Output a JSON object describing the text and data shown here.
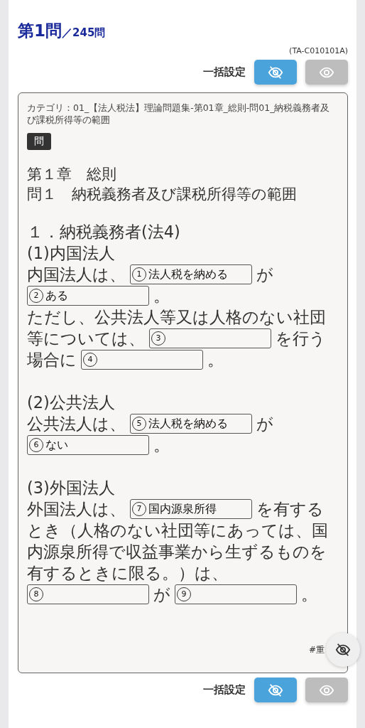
{
  "header": {
    "question": "第1問",
    "total": "／245問",
    "code": "(TA-C010101A)"
  },
  "bulk_top": {
    "label": "一括設定",
    "buttons": [
      {
        "kind": "hide",
        "selected": true
      },
      {
        "kind": "show",
        "selected": false
      }
    ]
  },
  "card": {
    "category": "カテゴリ：01_【法人税法】理論問題集-第01章_総則-問01_納税義務者及び課税所得等の範囲",
    "badge": "問",
    "heading": [
      "第１章　総則",
      "問１　納税義務者及び課税所得等の範囲"
    ],
    "paragraphs": [
      [
        [
          {
            "kind": "text",
            "text": "１．納税義務者(法4)"
          }
        ],
        [
          {
            "kind": "text",
            "text": "(1)内国法人"
          }
        ],
        [
          {
            "kind": "text",
            "text": "内国法人は、"
          },
          {
            "kind": "blank",
            "number": "1",
            "value": "法人税を納める"
          },
          {
            "kind": "text",
            "text": "が"
          }
        ],
        [
          {
            "kind": "blank",
            "number": "2",
            "value": "ある"
          },
          {
            "kind": "text",
            "text": "。"
          }
        ],
        [
          {
            "kind": "text",
            "text": "ただし、公共法人等又は人格のない社団"
          }
        ],
        [
          {
            "kind": "text",
            "text": "等については、"
          },
          {
            "kind": "blank",
            "number": "3"
          },
          {
            "kind": "text",
            "text": "を行う"
          }
        ],
        [
          {
            "kind": "text",
            "text": "場合に"
          },
          {
            "kind": "blank",
            "number": "4"
          },
          {
            "kind": "text",
            "text": "。"
          }
        ]
      ],
      [
        [
          {
            "kind": "text",
            "text": "(2)公共法人"
          }
        ],
        [
          {
            "kind": "text",
            "text": "公共法人は、"
          },
          {
            "kind": "blank",
            "number": "5",
            "value": "法人税を納める"
          },
          {
            "kind": "text",
            "text": "が"
          }
        ],
        [
          {
            "kind": "blank",
            "number": "6",
            "value": "ない"
          },
          {
            "kind": "text",
            "text": "。"
          }
        ]
      ],
      [
        [
          {
            "kind": "text",
            "text": "(3)外国法人"
          }
        ],
        [
          {
            "kind": "text",
            "text": "外国法人は、"
          },
          {
            "kind": "blank",
            "number": "7",
            "value": "国内源泉所得"
          },
          {
            "kind": "text",
            "text": "を有する"
          }
        ],
        [
          {
            "kind": "text",
            "text": "とき（人格のない社団等にあっては、国"
          }
        ],
        [
          {
            "kind": "text",
            "text": "内源泉所得で収益事業から生ずるものを"
          }
        ],
        [
          {
            "kind": "text",
            "text": "有するときに限る。）は、"
          }
        ],
        [
          {
            "kind": "blank",
            "number": "8"
          },
          {
            "kind": "text",
            "text": "が"
          },
          {
            "kind": "blank",
            "number": "9"
          },
          {
            "kind": "text",
            "text": "。"
          }
        ]
      ]
    ],
    "tag": "#重"
  },
  "bulk_bottom": {
    "label": "一括設定",
    "buttons": [
      {
        "kind": "hide",
        "selected": true
      },
      {
        "kind": "show",
        "selected": false
      }
    ]
  }
}
